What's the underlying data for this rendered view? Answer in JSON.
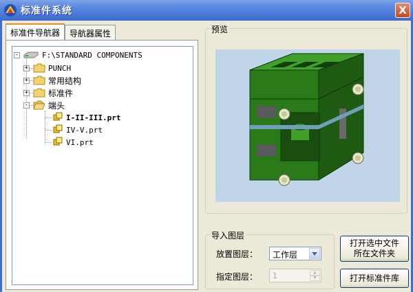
{
  "window": {
    "title": "标准件系统",
    "close_glyph": "X",
    "accent": "#3d6ccd"
  },
  "tabs": [
    {
      "label": "标准件导航器",
      "active": true
    },
    {
      "label": "导航器属性",
      "active": false
    }
  ],
  "tree": {
    "root": {
      "label": "F:\\STANDARD COMPONENTS",
      "icon": "drive-icon",
      "expander": "-"
    },
    "items": [
      {
        "label": "PUNCH",
        "icon": "folder-icon",
        "expander": "+"
      },
      {
        "label": "常用结构",
        "icon": "folder-icon",
        "expander": "+"
      },
      {
        "label": "标准件",
        "icon": "folder-icon",
        "expander": "+"
      },
      {
        "label": "端头",
        "icon": "folder-open-icon",
        "expander": "-",
        "children": [
          {
            "label": "I-II-III.prt",
            "icon": "part-icon",
            "bold": true
          },
          {
            "label": "IV-V.prt",
            "icon": "part-icon",
            "bold": false
          },
          {
            "label": "VI.prt",
            "icon": "part-icon",
            "bold": false
          }
        ]
      }
    ]
  },
  "preview": {
    "legend": "预览",
    "background": "#c0d6e8",
    "model_color": "#2f8a1f"
  },
  "import_layer": {
    "legend": "导入图层",
    "place_layer_label": "放置图层：",
    "place_layer_value": "工作层",
    "specify_layer_label": "指定图层：",
    "specify_layer_value": "1"
  },
  "buttons": {
    "open_folder_line1": "打开选中文件",
    "open_folder_line2": "所在文件夹",
    "open_library": "打开标准件库"
  }
}
